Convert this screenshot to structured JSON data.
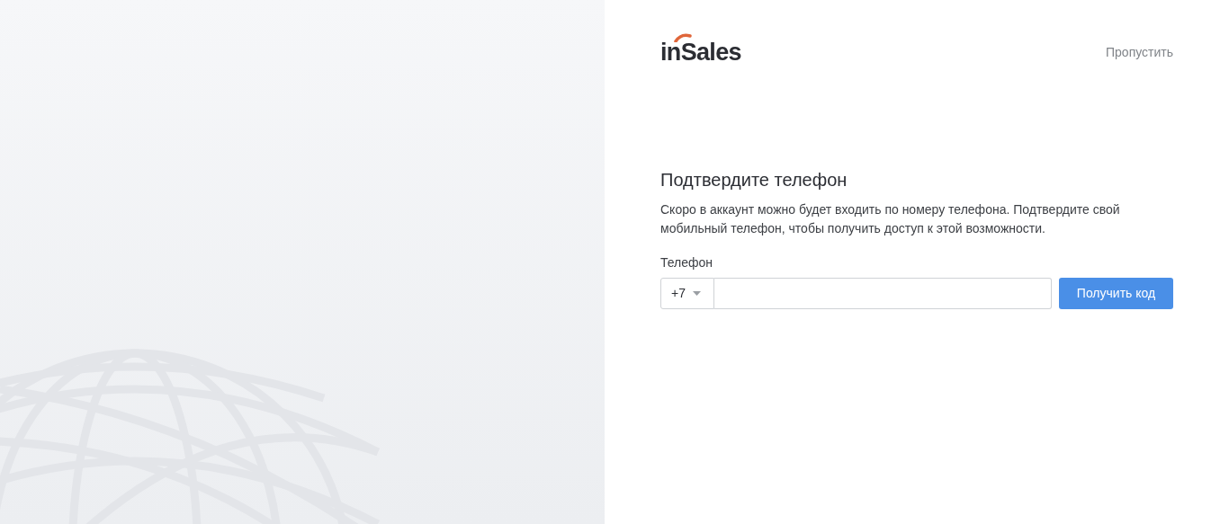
{
  "logo": {
    "text": "inSales"
  },
  "skip_link": "Пропустить",
  "form": {
    "title": "Подтвердите телефон",
    "description": "Скоро в аккаунт можно будет входить по номеру телефона. Подтвердите свой мобильный телефон, чтобы получить доступ к этой возможности.",
    "phone_label": "Телефон",
    "country_code": "+7",
    "submit_button": "Получить код"
  }
}
